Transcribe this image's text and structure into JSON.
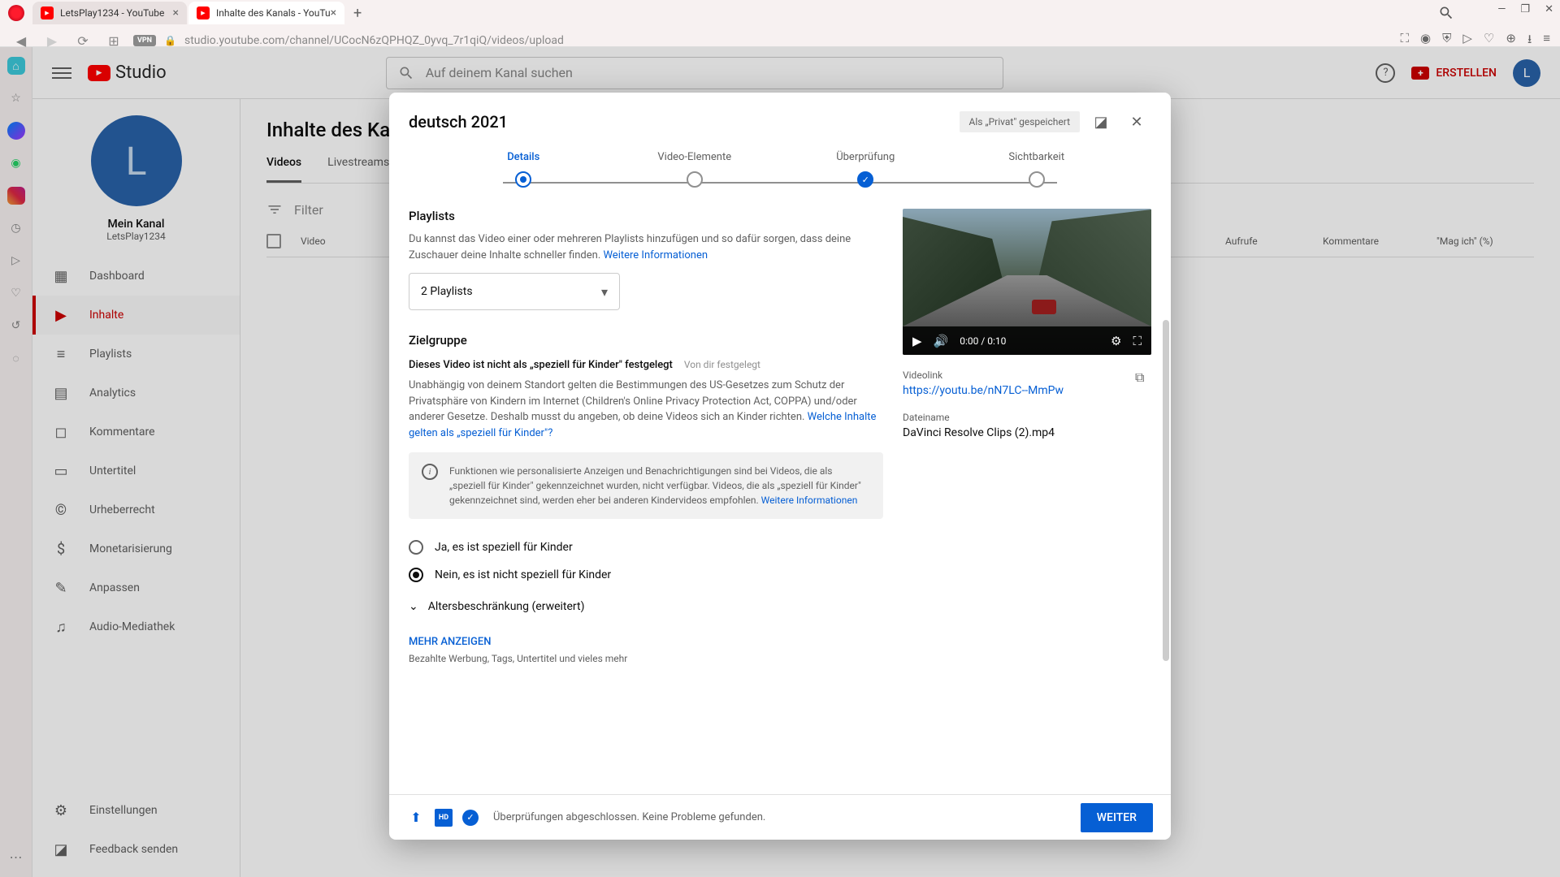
{
  "browser": {
    "tabs": [
      {
        "title": "LetsPlay1234 - YouTube"
      },
      {
        "title": "Inhalte des Kanals - YouTu"
      }
    ],
    "url": "studio.youtube.com/channel/UCocN6zQPHQZ_0yvq_7r1qiQ/videos/upload",
    "vpn": "VPN"
  },
  "header": {
    "logo": "Studio",
    "search_placeholder": "Auf deinem Kanal suchen",
    "create": "ERSTELLEN",
    "avatar": "L"
  },
  "sidebar": {
    "channel_letter": "L",
    "channel_name": "Mein Kanal",
    "channel_handle": "LetsPlay1234",
    "items": [
      {
        "label": "Dashboard"
      },
      {
        "label": "Inhalte"
      },
      {
        "label": "Playlists"
      },
      {
        "label": "Analytics"
      },
      {
        "label": "Kommentare"
      },
      {
        "label": "Untertitel"
      },
      {
        "label": "Urheberrecht"
      },
      {
        "label": "Monetarisierung"
      },
      {
        "label": "Anpassen"
      },
      {
        "label": "Audio-Mediathek"
      }
    ],
    "bottom": [
      {
        "label": "Einstellungen"
      },
      {
        "label": "Feedback senden"
      }
    ]
  },
  "main": {
    "title": "Inhalte des Kanals",
    "tabs": [
      "Videos",
      "Livestreams"
    ],
    "filter": "Filter",
    "columns": {
      "video": "Video",
      "views": "Aufrufe",
      "comments": "Kommentare",
      "likes": "\"Mag ich\" (%)"
    }
  },
  "modal": {
    "title": "deutsch 2021",
    "saved": "Als „Privat\" gespeichert",
    "steps": [
      "Details",
      "Video-Elemente",
      "Überprüfung",
      "Sichtbarkeit"
    ],
    "playlists": {
      "title": "Playlists",
      "desc": "Du kannst das Video einer oder mehreren Playlists hinzufügen und so dafür sorgen, dass deine Zuschauer deine Inhalte schneller finden. ",
      "more": "Weitere Informationen",
      "value": "2 Playlists"
    },
    "audience": {
      "title": "Zielgruppe",
      "status": "Dieses Video ist nicht als „speziell für Kinder\" festgelegt",
      "set_by": "Von dir festgelegt",
      "desc": "Unabhängig von deinem Standort gelten die Bestimmungen des US-Gesetzes zum Schutz der Privatsphäre von Kindern im Internet (Children's Online Privacy Protection Act, COPPA) und/oder anderer Gesetze. Deshalb musst du angeben, ob deine Videos sich an Kinder richten. ",
      "desc_link": "Welche Inhalte gelten als „speziell für Kinder\"?",
      "info": "Funktionen wie personalisierte Anzeigen und Benachrichtigungen sind bei Videos, die als „speziell für Kinder\" gekennzeichnet wurden, nicht verfügbar. Videos, die als „speziell für Kinder\" gekennzeichnet sind, werden eher bei anderen Kindervideos empfohlen. ",
      "info_link": "Weitere Informationen",
      "option_yes": "Ja, es ist speziell für Kinder",
      "option_no": "Nein, es ist nicht speziell für Kinder",
      "age_restriction": "Altersbeschränkung (erweitert)"
    },
    "show_more": "Mehr anzeigen",
    "show_more_desc": "Bezahlte Werbung, Tags, Untertitel und vieles mehr",
    "preview": {
      "time": "0:00 / 0:10",
      "link_label": "Videolink",
      "link": "https://youtu.be/nN7LC--MmPw",
      "filename_label": "Dateiname",
      "filename": "DaVinci Resolve Clips (2).mp4"
    },
    "footer": {
      "hd": "HD",
      "checks": "Überprüfungen abgeschlossen. Keine Probleme gefunden.",
      "next": "WEITER"
    }
  }
}
